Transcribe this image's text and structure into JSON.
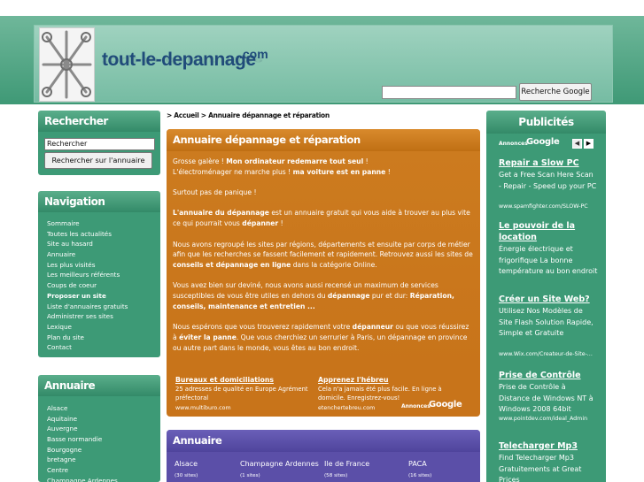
{
  "header": {
    "site_title": "tout-le-depannage",
    "site_title_sup": ".com",
    "google_button": "Recherche Google"
  },
  "search_panel": {
    "title": "Rechercher",
    "input_value": "Rechercher",
    "button_label": "Rechercher sur l'annuaire"
  },
  "navigation": {
    "title": "Navigation",
    "items": [
      {
        "label": "Sommaire",
        "bold": false
      },
      {
        "label": "Toutes les actualités",
        "bold": false
      },
      {
        "label": "Site au hasard",
        "bold": false
      },
      {
        "label": "Annuaire",
        "bold": false
      },
      {
        "label": "Les plus visités",
        "bold": false
      },
      {
        "label": "Les meilleurs référents",
        "bold": false
      },
      {
        "label": "Coups de coeur",
        "bold": false
      },
      {
        "label": "Proposer un site",
        "bold": true
      },
      {
        "label": "Liste d'annuaires gratuits",
        "bold": false
      },
      {
        "label": "Administrer ses sites",
        "bold": false
      },
      {
        "label": "Lexique",
        "bold": false
      },
      {
        "label": "Plan du site",
        "bold": false
      },
      {
        "label": "Contact",
        "bold": false
      }
    ]
  },
  "annuaire_side": {
    "title": "Annuaire",
    "items": [
      "Alsace",
      "Aquitaine",
      "Auvergne",
      "Basse normandie",
      "Bourgogne",
      "bretagne",
      "Centre",
      "Champagne Ardennes"
    ]
  },
  "breadcrumb": "> Accueil > Annuaire dépannage et réparation",
  "main": {
    "title": "Annuaire dépannage et réparation",
    "p1_a": "Grosse galère ! ",
    "p1_b": "Mon ordinateur redemarre tout seul",
    "p1_c": " !",
    "p1_d": "L'électroménager ne marche plus ! ",
    "p1_e": "ma voiture est en panne",
    "p1_f": " !",
    "p2": "Surtout pas de panique !",
    "p3_a": "L'annuaire du dépannage",
    "p3_b": " est un annuaire gratuit qui vous aide à trouver au plus vite ce qui pourrait vous ",
    "p3_c": "dépanner",
    "p3_d": " !",
    "p4_a": "Nous avons regroupé les sites par régions, départements et ensuite par corps de métier afin que les recherches se fassent facilement et rapidement. Retrouvez aussi les sites de ",
    "p4_b": "conseils et dépannage en ligne",
    "p4_c": " dans la catégorie Online.",
    "p5_a": "Vous avez bien sur deviné, nous avons aussi recensé un maximum de services susceptibles de vous être utiles en dehors du ",
    "p5_b": "dépannage",
    "p5_c": " pur et dur: ",
    "p5_d": "Réparation, conseils, maintenance et entretien ...",
    "p6_a": "Nous espérons que vous trouverez rapidement votre ",
    "p6_b": "dépanneur",
    "p6_c": " ou que vous réussirez à ",
    "p6_d": "éviter la panne",
    "p6_e": ". Que vous cherchiez un serrurier à Paris, un dépannage en province ou autre part dans le monde, vous êtes au bon endroit."
  },
  "center_ads": {
    "annonces_label": "Annonces",
    "google_word": "Google",
    "ads": [
      {
        "title": "Bureaux et domiciliations",
        "text": "25 adresses de qualité en Europe Agrément préfectoral",
        "url": "www.multiburo.com"
      },
      {
        "title": "Apprenez l'hébreu",
        "text": "Cela n'a jamais été plus facile. En ligne à domicile. Enregistrez-vous!",
        "url": "etenchertebreu.com"
      }
    ]
  },
  "annuaire_main": {
    "title": "Annuaire",
    "regions": [
      {
        "name": "Alsace",
        "count": "(30 sites)"
      },
      {
        "name": "Champagne Ardennes",
        "count": "(1 sites)"
      },
      {
        "name": "Ile de France",
        "count": "(58 sites)"
      },
      {
        "name": "PACA",
        "count": "(16 sites)"
      }
    ]
  },
  "publicites": {
    "title": "Publicités",
    "annonces_label": "Annonces",
    "google_word": "Google",
    "prev_arrow": "◀",
    "next_arrow": "▶",
    "ads": [
      {
        "title": "Repair a Slow PC",
        "text": "Get a Free Scan Here Scan - Repair - Speed up your PC",
        "url": "www.spamfighter.com/SLOW-PC"
      },
      {
        "title": "Le pouvoir de la location",
        "text": "Énergie électrique et frigorifique La bonne température au bon endroit",
        "url": ""
      },
      {
        "title": "Créer un Site Web?",
        "text": "Utilisez Nos Modèles de Site Flash Solution Rapide, Simple et Gratuite",
        "url": "www.Wix.com/Createur-de-Site-Web"
      },
      {
        "title": "Prise de Contrôle",
        "text": "Prise de Contrôle à Distance de Windows NT à Windows 2008 64bit",
        "url": "www.pointdev.com/ideal_Admin"
      },
      {
        "title": "Telecharger Mp3",
        "text": "Find Telecharger Mp3 Gratuitements at Great Prices",
        "url": ""
      }
    ]
  },
  "colors": {
    "green_dark": "#338a68",
    "green_panel": "#3d9a76",
    "orange": "#c8741a",
    "purple": "#5b4fa8",
    "title_blue": "#1f4b7a"
  }
}
